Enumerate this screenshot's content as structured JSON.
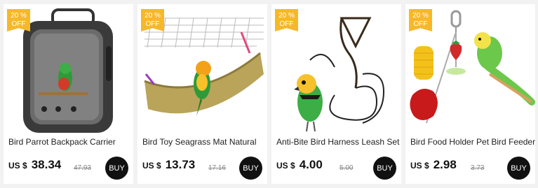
{
  "products": [
    {
      "badge_percent": "20 %",
      "badge_off": "OFF",
      "title": "Bird Parrot Backpack Carrier",
      "currency": "US $",
      "price": "38.34",
      "old_price": "47.93",
      "buy_label": "BUY"
    },
    {
      "badge_percent": "20 %",
      "badge_off": "OFF",
      "title": "Bird Toy Seagrass Mat Natural",
      "currency": "US $",
      "price": "13.73",
      "old_price": "17.16",
      "buy_label": "BUY"
    },
    {
      "badge_percent": "20 %",
      "badge_off": "OFF",
      "title": "Anti-Bite Bird Harness Leash Set",
      "currency": "US $",
      "price": "4.00",
      "old_price": "5.00",
      "buy_label": "BUY"
    },
    {
      "badge_percent": "20 %",
      "badge_off": "OFF",
      "title": "Bird Food Holder Pet Bird Feeder",
      "currency": "US $",
      "price": "2.98",
      "old_price": "3.73",
      "buy_label": "BUY"
    }
  ],
  "colors": {
    "badge": "#f6b82a",
    "buy_button": "#111111",
    "background": "#f2f2f2"
  }
}
